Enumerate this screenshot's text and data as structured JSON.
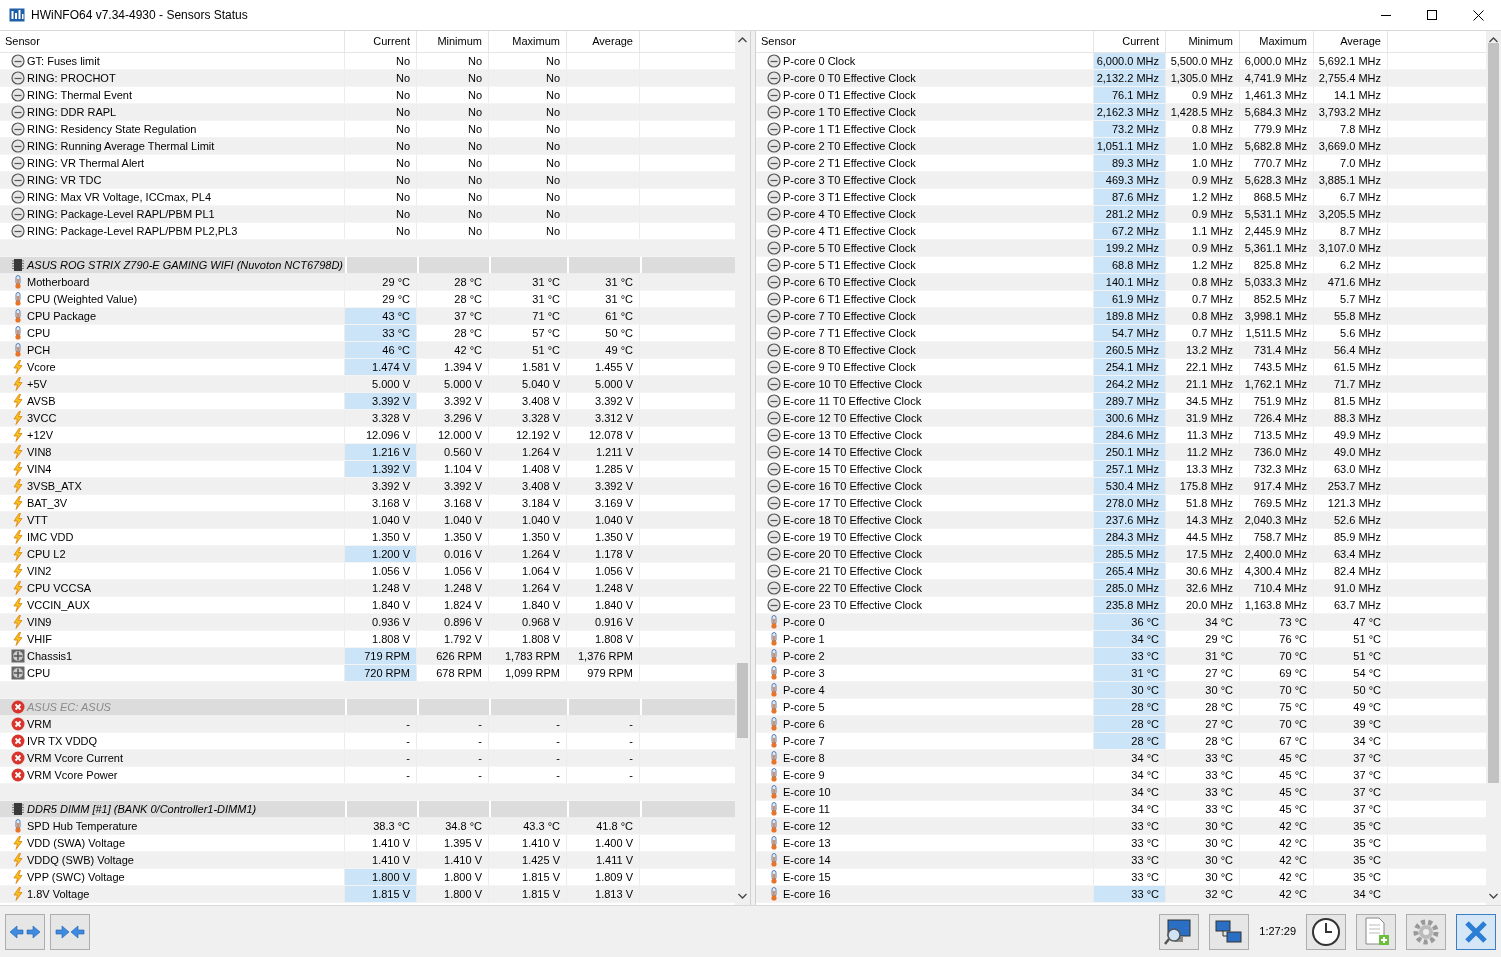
{
  "window": {
    "title": "HWiNFO64 v7.34-4930 - Sensors Status"
  },
  "left_panel": {
    "columns": [
      "Sensor",
      "Current",
      "Minimum",
      "Maximum",
      "Average"
    ],
    "rows": [
      {
        "kind": "clock",
        "sensor": "GT: Fuses limit",
        "current": "No",
        "minimum": "No",
        "maximum": "No",
        "highlighted": false
      },
      {
        "kind": "clock",
        "sensor": "RING: PROCHOT",
        "current": "No",
        "minimum": "No",
        "maximum": "No",
        "highlighted": false
      },
      {
        "kind": "clock",
        "sensor": "RING: Thermal Event",
        "current": "No",
        "minimum": "No",
        "maximum": "No",
        "highlighted": false
      },
      {
        "kind": "clock",
        "sensor": "RING: DDR RAPL",
        "current": "No",
        "minimum": "No",
        "maximum": "No",
        "highlighted": false
      },
      {
        "kind": "clock",
        "sensor": "RING: Residency State Regulation",
        "current": "No",
        "minimum": "No",
        "maximum": "No",
        "highlighted": false
      },
      {
        "kind": "clock",
        "sensor": "RING: Running Average Thermal Limit",
        "current": "No",
        "minimum": "No",
        "maximum": "No",
        "highlighted": false
      },
      {
        "kind": "clock",
        "sensor": "RING: VR Thermal Alert",
        "current": "No",
        "minimum": "No",
        "maximum": "No",
        "highlighted": false
      },
      {
        "kind": "clock",
        "sensor": "RING: VR TDC",
        "current": "No",
        "minimum": "No",
        "maximum": "No",
        "highlighted": false
      },
      {
        "kind": "clock",
        "sensor": "RING: Max VR Voltage, ICCmax, PL4",
        "current": "No",
        "minimum": "No",
        "maximum": "No",
        "highlighted": false
      },
      {
        "kind": "clock",
        "sensor": "RING: Package-Level RAPL/PBM PL1",
        "current": "No",
        "minimum": "No",
        "maximum": "No",
        "highlighted": false
      },
      {
        "kind": "clock",
        "sensor": "RING: Package-Level RAPL/PBM PL2,PL3",
        "current": "No",
        "minimum": "No",
        "maximum": "No",
        "highlighted": false
      },
      {
        "kind": "spacer"
      },
      {
        "kind": "device_group",
        "label": "ASUS ROG STRIX Z790-E GAMING WIFI (Nuvoton NCT6798D)",
        "disabled": false
      },
      {
        "kind": "temperature",
        "sensor": "Motherboard",
        "current": "29 °C",
        "minimum": "28 °C",
        "maximum": "31 °C",
        "average": "31 °C",
        "highlighted": false
      },
      {
        "kind": "temperature",
        "sensor": "CPU (Weighted Value)",
        "current": "29 °C",
        "minimum": "28 °C",
        "maximum": "31 °C",
        "average": "31 °C",
        "highlighted": false
      },
      {
        "kind": "temperature",
        "sensor": "CPU Package",
        "current": "43 °C",
        "minimum": "37 °C",
        "maximum": "71 °C",
        "average": "61 °C",
        "highlighted": true
      },
      {
        "kind": "temperature",
        "sensor": "CPU",
        "current": "33 °C",
        "minimum": "28 °C",
        "maximum": "57 °C",
        "average": "50 °C",
        "highlighted": true
      },
      {
        "kind": "temperature",
        "sensor": "PCH",
        "current": "46 °C",
        "minimum": "42 °C",
        "maximum": "51 °C",
        "average": "49 °C",
        "highlighted": true
      },
      {
        "kind": "voltage",
        "sensor": "Vcore",
        "current": "1.474 V",
        "minimum": "1.394 V",
        "maximum": "1.581 V",
        "average": "1.455 V",
        "highlighted": true
      },
      {
        "kind": "voltage",
        "sensor": "+5V",
        "current": "5.000 V",
        "minimum": "5.000 V",
        "maximum": "5.040 V",
        "average": "5.000 V",
        "highlighted": false
      },
      {
        "kind": "voltage",
        "sensor": "AVSB",
        "current": "3.392 V",
        "minimum": "3.392 V",
        "maximum": "3.408 V",
        "average": "3.392 V",
        "highlighted": true
      },
      {
        "kind": "voltage",
        "sensor": "3VCC",
        "current": "3.328 V",
        "minimum": "3.296 V",
        "maximum": "3.328 V",
        "average": "3.312 V",
        "highlighted": false
      },
      {
        "kind": "voltage",
        "sensor": "+12V",
        "current": "12.096 V",
        "minimum": "12.000 V",
        "maximum": "12.192 V",
        "average": "12.078 V",
        "highlighted": false
      },
      {
        "kind": "voltage",
        "sensor": "VIN8",
        "current": "1.216 V",
        "minimum": "0.560 V",
        "maximum": "1.264 V",
        "average": "1.211 V",
        "highlighted": true
      },
      {
        "kind": "voltage",
        "sensor": "VIN4",
        "current": "1.392 V",
        "minimum": "1.104 V",
        "maximum": "1.408 V",
        "average": "1.285 V",
        "highlighted": true
      },
      {
        "kind": "voltage",
        "sensor": "3VSB_ATX",
        "current": "3.392 V",
        "minimum": "3.392 V",
        "maximum": "3.408 V",
        "average": "3.392 V",
        "highlighted": false
      },
      {
        "kind": "voltage",
        "sensor": "BAT_3V",
        "current": "3.168 V",
        "minimum": "3.168 V",
        "maximum": "3.184 V",
        "average": "3.169 V",
        "highlighted": false
      },
      {
        "kind": "voltage",
        "sensor": "VTT",
        "current": "1.040 V",
        "minimum": "1.040 V",
        "maximum": "1.040 V",
        "average": "1.040 V",
        "highlighted": false
      },
      {
        "kind": "voltage",
        "sensor": "IMC VDD",
        "current": "1.350 V",
        "minimum": "1.350 V",
        "maximum": "1.350 V",
        "average": "1.350 V",
        "highlighted": false
      },
      {
        "kind": "voltage",
        "sensor": "CPU L2",
        "current": "1.200 V",
        "minimum": "0.016 V",
        "maximum": "1.264 V",
        "average": "1.178 V",
        "highlighted": true
      },
      {
        "kind": "voltage",
        "sensor": "VIN2",
        "current": "1.056 V",
        "minimum": "1.056 V",
        "maximum": "1.064 V",
        "average": "1.056 V",
        "highlighted": false
      },
      {
        "kind": "voltage",
        "sensor": "CPU VCCSA",
        "current": "1.248 V",
        "minimum": "1.248 V",
        "maximum": "1.264 V",
        "average": "1.248 V",
        "highlighted": false
      },
      {
        "kind": "voltage",
        "sensor": "VCCIN_AUX",
        "current": "1.840 V",
        "minimum": "1.824 V",
        "maximum": "1.840 V",
        "average": "1.840 V",
        "highlighted": false
      },
      {
        "kind": "voltage",
        "sensor": "VIN9",
        "current": "0.936 V",
        "minimum": "0.896 V",
        "maximum": "0.968 V",
        "average": "0.916 V",
        "highlighted": false
      },
      {
        "kind": "voltage",
        "sensor": "VHIF",
        "current": "1.808 V",
        "minimum": "1.792 V",
        "maximum": "1.808 V",
        "average": "1.808 V",
        "highlighted": false
      },
      {
        "kind": "fan",
        "sensor": "Chassis1",
        "current": "719 RPM",
        "minimum": "626 RPM",
        "maximum": "1,783 RPM",
        "average": "1,376 RPM",
        "highlighted": true
      },
      {
        "kind": "fan",
        "sensor": "CPU",
        "current": "720 RPM",
        "minimum": "678 RPM",
        "maximum": "1,099 RPM",
        "average": "979 RPM",
        "highlighted": true
      },
      {
        "kind": "spacer"
      },
      {
        "kind": "failed_group",
        "label": "ASUS EC: ASUS",
        "disabled": true
      },
      {
        "kind": "failed",
        "sensor": "VRM",
        "current": "-",
        "minimum": "-",
        "maximum": "-",
        "average": "-",
        "highlighted": false
      },
      {
        "kind": "failed",
        "sensor": "IVR TX VDDQ",
        "current": "-",
        "minimum": "-",
        "maximum": "-",
        "average": "-",
        "highlighted": false
      },
      {
        "kind": "failed",
        "sensor": "VRM Vcore Current",
        "current": "-",
        "minimum": "-",
        "maximum": "-",
        "average": "-",
        "highlighted": false
      },
      {
        "kind": "failed",
        "sensor": "VRM Vcore Power",
        "current": "-",
        "minimum": "-",
        "maximum": "-",
        "average": "-",
        "highlighted": false
      },
      {
        "kind": "spacer"
      },
      {
        "kind": "device_group",
        "label": "DDR5 DIMM [#1] (BANK 0/Controller1-DIMM1)",
        "disabled": false
      },
      {
        "kind": "temperature",
        "sensor": "SPD Hub Temperature",
        "current": "38.3 °C",
        "minimum": "34.8 °C",
        "maximum": "43.3 °C",
        "average": "41.8 °C",
        "highlighted": false
      },
      {
        "kind": "voltage",
        "sensor": "VDD (SWA) Voltage",
        "current": "1.410 V",
        "minimum": "1.395 V",
        "maximum": "1.410 V",
        "average": "1.400 V",
        "highlighted": false
      },
      {
        "kind": "voltage",
        "sensor": "VDDQ (SWB) Voltage",
        "current": "1.410 V",
        "minimum": "1.410 V",
        "maximum": "1.425 V",
        "average": "1.411 V",
        "highlighted": false
      },
      {
        "kind": "voltage",
        "sensor": "VPP (SWC) Voltage",
        "current": "1.800 V",
        "minimum": "1.800 V",
        "maximum": "1.815 V",
        "average": "1.809 V",
        "highlighted": true
      },
      {
        "kind": "voltage",
        "sensor": "1.8V Voltage",
        "current": "1.815 V",
        "minimum": "1.800 V",
        "maximum": "1.815 V",
        "average": "1.813 V",
        "highlighted": true
      }
    ]
  },
  "right_panel": {
    "columns": [
      "Sensor",
      "Current",
      "Minimum",
      "Maximum",
      "Average"
    ],
    "rows": [
      {
        "kind": "clock",
        "sensor": "P-core 0 Clock",
        "current": "6,000.0 MHz",
        "minimum": "5,500.0 MHz",
        "maximum": "6,000.0 MHz",
        "average": "5,692.1 MHz",
        "highlighted": true
      },
      {
        "kind": "clock",
        "sensor": "P-core 0 T0 Effective Clock",
        "current": "2,132.2 MHz",
        "minimum": "1,305.0 MHz",
        "maximum": "4,741.9 MHz",
        "average": "2,755.4 MHz",
        "highlighted": true
      },
      {
        "kind": "clock",
        "sensor": "P-core 0 T1 Effective Clock",
        "current": "76.1 MHz",
        "minimum": "0.9 MHz",
        "maximum": "1,461.3 MHz",
        "average": "14.1 MHz",
        "highlighted": true
      },
      {
        "kind": "clock",
        "sensor": "P-core 1 T0 Effective Clock",
        "current": "2,162.3 MHz",
        "minimum": "1,428.5 MHz",
        "maximum": "5,684.3 MHz",
        "average": "3,793.2 MHz",
        "highlighted": true
      },
      {
        "kind": "clock",
        "sensor": "P-core 1 T1 Effective Clock",
        "current": "73.2 MHz",
        "minimum": "0.8 MHz",
        "maximum": "779.9 MHz",
        "average": "7.8 MHz",
        "highlighted": true
      },
      {
        "kind": "clock",
        "sensor": "P-core 2 T0 Effective Clock",
        "current": "1,051.1 MHz",
        "minimum": "1.0 MHz",
        "maximum": "5,682.8 MHz",
        "average": "3,669.0 MHz",
        "highlighted": true
      },
      {
        "kind": "clock",
        "sensor": "P-core 2 T1 Effective Clock",
        "current": "89.3 MHz",
        "minimum": "1.0 MHz",
        "maximum": "770.7 MHz",
        "average": "7.0 MHz",
        "highlighted": true
      },
      {
        "kind": "clock",
        "sensor": "P-core 3 T0 Effective Clock",
        "current": "469.3 MHz",
        "minimum": "0.9 MHz",
        "maximum": "5,628.3 MHz",
        "average": "3,885.1 MHz",
        "highlighted": true
      },
      {
        "kind": "clock",
        "sensor": "P-core 3 T1 Effective Clock",
        "current": "87.6 MHz",
        "minimum": "1.2 MHz",
        "maximum": "868.5 MHz",
        "average": "6.7 MHz",
        "highlighted": true
      },
      {
        "kind": "clock",
        "sensor": "P-core 4 T0 Effective Clock",
        "current": "281.2 MHz",
        "minimum": "0.9 MHz",
        "maximum": "5,531.1 MHz",
        "average": "3,205.5 MHz",
        "highlighted": true
      },
      {
        "kind": "clock",
        "sensor": "P-core 4 T1 Effective Clock",
        "current": "67.2 MHz",
        "minimum": "1.1 MHz",
        "maximum": "2,445.9 MHz",
        "average": "8.7 MHz",
        "highlighted": true
      },
      {
        "kind": "clock",
        "sensor": "P-core 5 T0 Effective Clock",
        "current": "199.2 MHz",
        "minimum": "0.9 MHz",
        "maximum": "5,361.1 MHz",
        "average": "3,107.0 MHz",
        "highlighted": true
      },
      {
        "kind": "clock",
        "sensor": "P-core 5 T1 Effective Clock",
        "current": "68.8 MHz",
        "minimum": "1.2 MHz",
        "maximum": "825.8 MHz",
        "average": "6.2 MHz",
        "highlighted": true
      },
      {
        "kind": "clock",
        "sensor": "P-core 6 T0 Effective Clock",
        "current": "140.1 MHz",
        "minimum": "0.8 MHz",
        "maximum": "5,033.3 MHz",
        "average": "471.6 MHz",
        "highlighted": true
      },
      {
        "kind": "clock",
        "sensor": "P-core 6 T1 Effective Clock",
        "current": "61.9 MHz",
        "minimum": "0.7 MHz",
        "maximum": "852.5 MHz",
        "average": "5.7 MHz",
        "highlighted": true
      },
      {
        "kind": "clock",
        "sensor": "P-core 7 T0 Effective Clock",
        "current": "189.8 MHz",
        "minimum": "0.8 MHz",
        "maximum": "3,998.1 MHz",
        "average": "55.8 MHz",
        "highlighted": true
      },
      {
        "kind": "clock",
        "sensor": "P-core 7 T1 Effective Clock",
        "current": "54.7 MHz",
        "minimum": "0.7 MHz",
        "maximum": "1,511.5 MHz",
        "average": "5.6 MHz",
        "highlighted": true
      },
      {
        "kind": "clock",
        "sensor": "E-core 8 T0 Effective Clock",
        "current": "260.5 MHz",
        "minimum": "13.2 MHz",
        "maximum": "731.4 MHz",
        "average": "56.4 MHz",
        "highlighted": true
      },
      {
        "kind": "clock",
        "sensor": "E-core 9 T0 Effective Clock",
        "current": "254.1 MHz",
        "minimum": "22.1 MHz",
        "maximum": "743.5 MHz",
        "average": "61.5 MHz",
        "highlighted": true
      },
      {
        "kind": "clock",
        "sensor": "E-core 10 T0 Effective Clock",
        "current": "264.2 MHz",
        "minimum": "21.1 MHz",
        "maximum": "1,762.1 MHz",
        "average": "71.7 MHz",
        "highlighted": true
      },
      {
        "kind": "clock",
        "sensor": "E-core 11 T0 Effective Clock",
        "current": "289.7 MHz",
        "minimum": "34.5 MHz",
        "maximum": "751.9 MHz",
        "average": "81.5 MHz",
        "highlighted": true
      },
      {
        "kind": "clock",
        "sensor": "E-core 12 T0 Effective Clock",
        "current": "300.6 MHz",
        "minimum": "31.9 MHz",
        "maximum": "726.4 MHz",
        "average": "88.3 MHz",
        "highlighted": true
      },
      {
        "kind": "clock",
        "sensor": "E-core 13 T0 Effective Clock",
        "current": "284.6 MHz",
        "minimum": "11.3 MHz",
        "maximum": "713.5 MHz",
        "average": "49.9 MHz",
        "highlighted": true
      },
      {
        "kind": "clock",
        "sensor": "E-core 14 T0 Effective Clock",
        "current": "250.1 MHz",
        "minimum": "11.2 MHz",
        "maximum": "736.0 MHz",
        "average": "49.0 MHz",
        "highlighted": true
      },
      {
        "kind": "clock",
        "sensor": "E-core 15 T0 Effective Clock",
        "current": "257.1 MHz",
        "minimum": "13.3 MHz",
        "maximum": "732.3 MHz",
        "average": "63.0 MHz",
        "highlighted": true
      },
      {
        "kind": "clock",
        "sensor": "E-core 16 T0 Effective Clock",
        "current": "530.4 MHz",
        "minimum": "175.8 MHz",
        "maximum": "917.4 MHz",
        "average": "253.7 MHz",
        "highlighted": true
      },
      {
        "kind": "clock",
        "sensor": "E-core 17 T0 Effective Clock",
        "current": "278.0 MHz",
        "minimum": "51.8 MHz",
        "maximum": "769.5 MHz",
        "average": "121.3 MHz",
        "highlighted": true
      },
      {
        "kind": "clock",
        "sensor": "E-core 18 T0 Effective Clock",
        "current": "237.6 MHz",
        "minimum": "14.3 MHz",
        "maximum": "2,040.3 MHz",
        "average": "52.6 MHz",
        "highlighted": true
      },
      {
        "kind": "clock",
        "sensor": "E-core 19 T0 Effective Clock",
        "current": "284.3 MHz",
        "minimum": "44.5 MHz",
        "maximum": "758.7 MHz",
        "average": "85.9 MHz",
        "highlighted": true
      },
      {
        "kind": "clock",
        "sensor": "E-core 20 T0 Effective Clock",
        "current": "285.5 MHz",
        "minimum": "17.5 MHz",
        "maximum": "2,400.0 MHz",
        "average": "63.4 MHz",
        "highlighted": true
      },
      {
        "kind": "clock",
        "sensor": "E-core 21 T0 Effective Clock",
        "current": "265.4 MHz",
        "minimum": "30.6 MHz",
        "maximum": "4,300.4 MHz",
        "average": "82.4 MHz",
        "highlighted": true
      },
      {
        "kind": "clock",
        "sensor": "E-core 22 T0 Effective Clock",
        "current": "285.0 MHz",
        "minimum": "32.6 MHz",
        "maximum": "710.4 MHz",
        "average": "91.0 MHz",
        "highlighted": true
      },
      {
        "kind": "clock",
        "sensor": "E-core 23 T0 Effective Clock",
        "current": "235.8 MHz",
        "minimum": "20.0 MHz",
        "maximum": "1,163.8 MHz",
        "average": "63.7 MHz",
        "highlighted": true
      },
      {
        "kind": "temperature",
        "sensor": "P-core 0",
        "current": "36 °C",
        "minimum": "34 °C",
        "maximum": "73 °C",
        "average": "47 °C",
        "highlighted": true
      },
      {
        "kind": "temperature",
        "sensor": "P-core 1",
        "current": "34 °C",
        "minimum": "29 °C",
        "maximum": "76 °C",
        "average": "51 °C",
        "highlighted": true
      },
      {
        "kind": "temperature",
        "sensor": "P-core 2",
        "current": "33 °C",
        "minimum": "31 °C",
        "maximum": "70 °C",
        "average": "51 °C",
        "highlighted": true
      },
      {
        "kind": "temperature",
        "sensor": "P-core 3",
        "current": "31 °C",
        "minimum": "27 °C",
        "maximum": "69 °C",
        "average": "54 °C",
        "highlighted": true
      },
      {
        "kind": "temperature",
        "sensor": "P-core 4",
        "current": "30 °C",
        "minimum": "30 °C",
        "maximum": "70 °C",
        "average": "50 °C",
        "highlighted": true
      },
      {
        "kind": "temperature",
        "sensor": "P-core 5",
        "current": "28 °C",
        "minimum": "28 °C",
        "maximum": "75 °C",
        "average": "49 °C",
        "highlighted": true
      },
      {
        "kind": "temperature",
        "sensor": "P-core 6",
        "current": "28 °C",
        "minimum": "27 °C",
        "maximum": "70 °C",
        "average": "39 °C",
        "highlighted": true
      },
      {
        "kind": "temperature",
        "sensor": "P-core 7",
        "current": "28 °C",
        "minimum": "28 °C",
        "maximum": "67 °C",
        "average": "34 °C",
        "highlighted": true
      },
      {
        "kind": "temperature",
        "sensor": "E-core 8",
        "current": "34 °C",
        "minimum": "33 °C",
        "maximum": "45 °C",
        "average": "37 °C",
        "highlighted": false
      },
      {
        "kind": "temperature",
        "sensor": "E-core 9",
        "current": "34 °C",
        "minimum": "33 °C",
        "maximum": "45 °C",
        "average": "37 °C",
        "highlighted": false
      },
      {
        "kind": "temperature",
        "sensor": "E-core 10",
        "current": "34 °C",
        "minimum": "33 °C",
        "maximum": "45 °C",
        "average": "37 °C",
        "highlighted": false
      },
      {
        "kind": "temperature",
        "sensor": "E-core 11",
        "current": "34 °C",
        "minimum": "33 °C",
        "maximum": "45 °C",
        "average": "37 °C",
        "highlighted": false
      },
      {
        "kind": "temperature",
        "sensor": "E-core 12",
        "current": "33 °C",
        "minimum": "30 °C",
        "maximum": "42 °C",
        "average": "35 °C",
        "highlighted": false
      },
      {
        "kind": "temperature",
        "sensor": "E-core 13",
        "current": "33 °C",
        "minimum": "30 °C",
        "maximum": "42 °C",
        "average": "35 °C",
        "highlighted": false
      },
      {
        "kind": "temperature",
        "sensor": "E-core 14",
        "current": "33 °C",
        "minimum": "30 °C",
        "maximum": "42 °C",
        "average": "35 °C",
        "highlighted": false
      },
      {
        "kind": "temperature",
        "sensor": "E-core 15",
        "current": "33 °C",
        "minimum": "30 °C",
        "maximum": "42 °C",
        "average": "35 °C",
        "highlighted": false
      },
      {
        "kind": "temperature",
        "sensor": "E-core 16",
        "current": "33 °C",
        "minimum": "32 °C",
        "maximum": "42 °C",
        "average": "34 °C",
        "highlighted": true
      }
    ]
  },
  "toolbar": {
    "time": "1:27:29"
  }
}
